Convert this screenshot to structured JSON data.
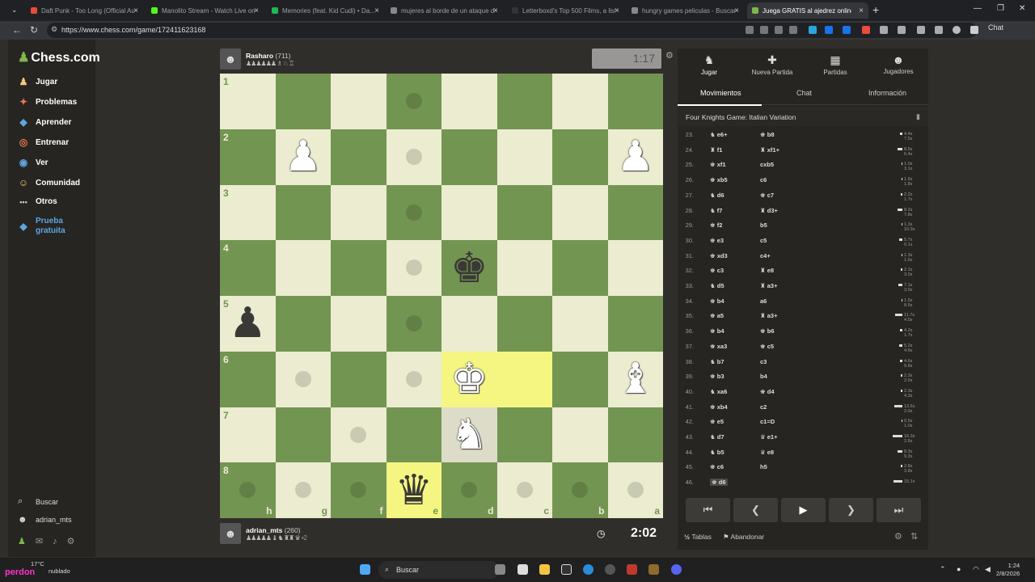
{
  "browser": {
    "tabs": [
      {
        "title": "Daft Punk - Too Long (Official Au...",
        "color": "#e74c3c"
      },
      {
        "title": "Manolito Stream - Watch Live on ...",
        "color": "#53fc18"
      },
      {
        "title": "Memories (feat. Kid Cudi) • Da...",
        "color": "#1db954"
      },
      {
        "title": "mujeres al borde de un ataque de...",
        "color": "#888888"
      },
      {
        "title": "Letterboxd's Top 500 Films, a list ...",
        "color": "#333333"
      },
      {
        "title": "hungry games peliculas - Buscar c...",
        "color": "#888888"
      },
      {
        "title": "Juega GRATIS al ajedrez online...",
        "color": "#81b64c"
      }
    ],
    "url": "https://www.chess.com/game/172411623168",
    "chat_label": "Chat"
  },
  "site": {
    "logo": "Chess.com",
    "nav": [
      {
        "label": "Jugar",
        "icon": "play-icon",
        "glyph": "♟",
        "color": "#f5c87a"
      },
      {
        "label": "Problemas",
        "icon": "puzzle-icon",
        "glyph": "✦",
        "color": "#e8784d"
      },
      {
        "label": "Aprender",
        "icon": "learn-icon",
        "glyph": "◆",
        "color": "#5ea5e0"
      },
      {
        "label": "Entrenar",
        "icon": "train-icon",
        "glyph": "◎",
        "color": "#e8784d"
      },
      {
        "label": "Ver",
        "icon": "watch-icon",
        "glyph": "◉",
        "color": "#5ea5e0"
      },
      {
        "label": "Comunidad",
        "icon": "community-icon",
        "glyph": "☺",
        "color": "#f5c87a"
      },
      {
        "label": "Otros",
        "icon": "more-icon",
        "glyph": "•••",
        "color": "#ccc"
      }
    ],
    "promo": "Prueba gratuita",
    "search_label": "Buscar",
    "username": "adrian_mts"
  },
  "game": {
    "top_player": {
      "name": "Rasharo",
      "rating": "(711)",
      "captured": "♟♟♟♟♟♟ ♗ ♘ ♖"
    },
    "bottom_player": {
      "name": "adrian_mts",
      "rating": "(260)",
      "captured": "♟♟♟♟♟ ♝ ♞ ♜♜ ♛",
      "diff": "+2"
    },
    "top_clock": "1:17",
    "bottom_clock": "2:02",
    "ranks": [
      "1",
      "2",
      "3",
      "4",
      "5",
      "6",
      "7",
      "8"
    ],
    "files": [
      "h",
      "g",
      "f",
      "e",
      "d",
      "c",
      "b",
      "a"
    ]
  },
  "panel": {
    "tabs": [
      {
        "label": "Jugar",
        "glyph": "♞"
      },
      {
        "label": "Nueva Partida",
        "glyph": "✚"
      },
      {
        "label": "Partidas",
        "glyph": "▦"
      },
      {
        "label": "Jugadores",
        "glyph": "☻"
      }
    ],
    "subtabs": [
      "Movimientos",
      "Chat",
      "Información"
    ],
    "opening": "Four Knights Game: Italian Variation",
    "moves": [
      {
        "n": "23.",
        "w": "e6+",
        "wp": "♞",
        "b": "b8",
        "bp": "♚",
        "t1": "4.4s",
        "t2": "7.5s"
      },
      {
        "n": "24.",
        "w": "f1",
        "wp": "♜",
        "b": "xf1+",
        "bp": "♜",
        "t1": "8.5s",
        "t2": "6.4s"
      },
      {
        "n": "25.",
        "w": "xf1",
        "wp": "♚",
        "b": "cxb5",
        "bp": "",
        "t1": "1.0s",
        "t2": "3.1s"
      },
      {
        "n": "26.",
        "w": "xb5",
        "wp": "♚",
        "b": "c6",
        "bp": "",
        "t1": "1.5s",
        "t2": "1.8s"
      },
      {
        "n": "27.",
        "w": "d6",
        "wp": "♞",
        "b": "c7",
        "bp": "♚",
        "t1": "2.2s",
        "t2": "1.7s"
      },
      {
        "n": "28.",
        "w": "f7",
        "wp": "♞",
        "b": "d3+",
        "bp": "♜",
        "t1": "8.2s",
        "t2": "7.8s"
      },
      {
        "n": "29.",
        "w": "f2",
        "wp": "♚",
        "b": "b5",
        "bp": "",
        "t1": "1.3s",
        "t2": "10.3s"
      },
      {
        "n": "30.",
        "w": "e3",
        "wp": "♚",
        "b": "c5",
        "bp": "",
        "t1": "5.7s",
        "t2": "0.1s"
      },
      {
        "n": "31.",
        "w": "xd3",
        "wp": "♚",
        "b": "c4+",
        "bp": "",
        "t1": "1.3s",
        "t2": "1.5s"
      },
      {
        "n": "32.",
        "w": "c3",
        "wp": "♚",
        "b": "e8",
        "bp": "♜",
        "t1": "2.1s",
        "t2": "3.0s"
      },
      {
        "n": "33.",
        "w": "d5",
        "wp": "♞",
        "b": "a3+",
        "bp": "♜",
        "t1": "7.1s",
        "t2": "3.0s"
      },
      {
        "n": "34.",
        "w": "b4",
        "wp": "♚",
        "b": "a6",
        "bp": "",
        "t1": "1.5s",
        "t2": "8.5s"
      },
      {
        "n": "35.",
        "w": "a5",
        "wp": "♚",
        "b": "a3+",
        "bp": "♜",
        "t1": "11.7s",
        "t2": "4.5s"
      },
      {
        "n": "36.",
        "w": "b4",
        "wp": "♚",
        "b": "b6",
        "bp": "♚",
        "t1": "4.2s",
        "t2": "1.7s"
      },
      {
        "n": "37.",
        "w": "xa3",
        "wp": "♚",
        "b": "c5",
        "bp": "♚",
        "t1": "5.2s",
        "t2": "4.6s"
      },
      {
        "n": "38.",
        "w": "b7",
        "wp": "♞",
        "b": "c3",
        "bp": "",
        "t1": "4.6s",
        "t2": "0.8s"
      },
      {
        "n": "39.",
        "w": "b3",
        "wp": "♚",
        "b": "b4",
        "bp": "",
        "t1": "2.3s",
        "t2": "2.0s"
      },
      {
        "n": "40.",
        "w": "xa6",
        "wp": "♞",
        "b": "d4",
        "bp": "♚",
        "t1": "2.3s",
        "t2": "4.3s"
      },
      {
        "n": "41.",
        "w": "xb4",
        "wp": "♚",
        "b": "c2",
        "bp": "",
        "t1": "13.6s",
        "t2": "2.0s"
      },
      {
        "n": "42.",
        "w": "e5",
        "wp": "♚",
        "b": "c1=D",
        "bp": "",
        "t1": "0.5s",
        "t2": "1.0s"
      },
      {
        "n": "43.",
        "w": "d7",
        "wp": "♞",
        "b": "e1+",
        "bp": "♛",
        "t1": "16.3s",
        "t2": "2.6s"
      },
      {
        "n": "44.",
        "w": "b5",
        "wp": "♞",
        "b": "e8",
        "bp": "♛",
        "t1": "8.3s",
        "t2": "9.3s"
      },
      {
        "n": "45.",
        "w": "c6",
        "wp": "♚",
        "b": "h5",
        "bp": "",
        "t1": "2.8s",
        "t2": "3.8s"
      },
      {
        "n": "46.",
        "w": "d6",
        "wp": "♚",
        "b": "",
        "bp": "",
        "t1": "15.1s",
        "t2": ""
      }
    ],
    "draw_label": "Tablas",
    "resign_label": "Abandonar",
    "draw_glyph": "½"
  },
  "taskbar": {
    "temp": "17°C",
    "weather": "nublado",
    "watermark": "perdon",
    "search": "Buscar",
    "time": "1:24",
    "date": "2/8/2026"
  }
}
